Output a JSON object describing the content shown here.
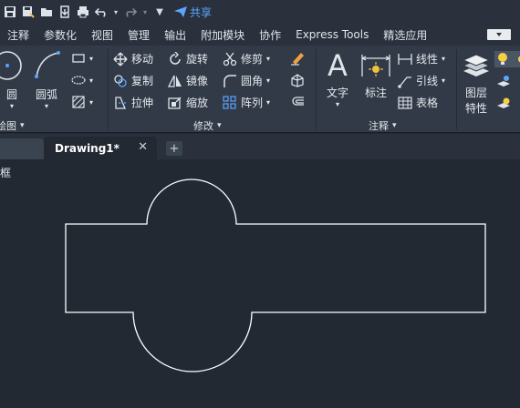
{
  "quick_access": {
    "share_label": "共享",
    "icons": [
      "save-icon",
      "save-as-icon",
      "open-icon",
      "export-icon",
      "print-icon",
      "undo-icon",
      "redo-icon",
      "customize-icon",
      "share-icon"
    ]
  },
  "menu": {
    "items": [
      "注释",
      "参数化",
      "视图",
      "管理",
      "输出",
      "附加模块",
      "协作",
      "Express Tools",
      "精选应用"
    ]
  },
  "ribbon": {
    "draw": {
      "circle_label": "圆",
      "arc_label": "圆弧",
      "panel_title": "绘图"
    },
    "modify": {
      "move": "移动",
      "rotate": "旋转",
      "trim": "修剪",
      "copy": "复制",
      "mirror": "镜像",
      "fillet": "圆角",
      "stretch": "拉伸",
      "scale": "缩放",
      "array": "阵列",
      "panel_title": "修改"
    },
    "annotation": {
      "text": "文字",
      "dimension": "标注",
      "linear": "线性",
      "leader": "引线",
      "table": "表格",
      "panel_title": "注释"
    },
    "layers": {
      "layer_props_line1": "图层",
      "layer_props_line2": "特性"
    }
  },
  "tabs": {
    "active": "Drawing1*",
    "close": "✕",
    "add": "+"
  },
  "viewport": {
    "label": "框"
  },
  "colors": {
    "background": "#222933",
    "ribbon": "#323a47",
    "accent": "#5aa6ff",
    "shape_stroke": "#ffffff"
  }
}
